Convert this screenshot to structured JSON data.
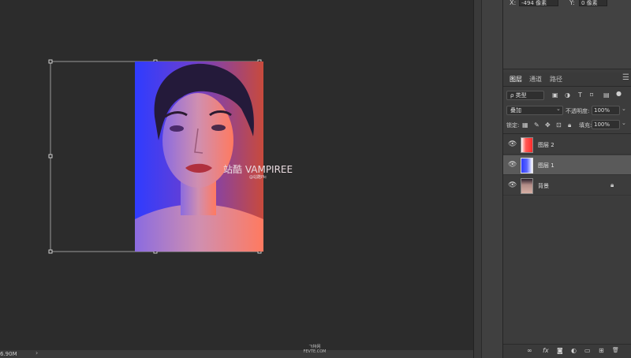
{
  "status": {
    "doc_size": "6.90M",
    "arrow": "›",
    "watermark_line1": "飞特网",
    "watermark_line2": "FEVTE.COM"
  },
  "canvas": {
    "watermark": "站酷 VAMPIREE",
    "watermark_sub": "@站酷Pic"
  },
  "properties": {
    "x_label": "X:",
    "x_value": "-494 像素",
    "y_label": "Y:",
    "y_value": "0 像素"
  },
  "layers_panel": {
    "tabs": [
      "图层",
      "通道",
      "路径"
    ],
    "menu_icon": "☰",
    "filter_kind": "ρ 类型",
    "blend_mode": "叠加",
    "opacity_label": "不透明度:",
    "opacity_value": "100%",
    "lock_label": "锁定:",
    "fill_label": "填充:",
    "fill_value": "100%",
    "layers": [
      {
        "name": "图层 2",
        "selected": false,
        "thumb": "red-gradient"
      },
      {
        "name": "图层 1",
        "selected": true,
        "thumb": "blue-gradient"
      },
      {
        "name": "背景",
        "selected": false,
        "thumb": "portrait",
        "locked": true
      }
    ],
    "bottom_icons": [
      "link-icon",
      "fx-icon",
      "mask-icon",
      "adjustment-icon",
      "folder-icon",
      "new-layer-icon",
      "trash-icon"
    ],
    "bottom_glyphs": [
      "∞",
      "fx",
      "◙",
      "◐",
      "▭",
      "⊞",
      "🗑"
    ]
  },
  "colors": {
    "canvas_bg": "#2c2c2c",
    "panel_bg": "#3c3c3c",
    "selected_layer": "#5a5a5a",
    "gradient_blue": "#2f3cff",
    "gradient_red": "#ff3b30"
  }
}
